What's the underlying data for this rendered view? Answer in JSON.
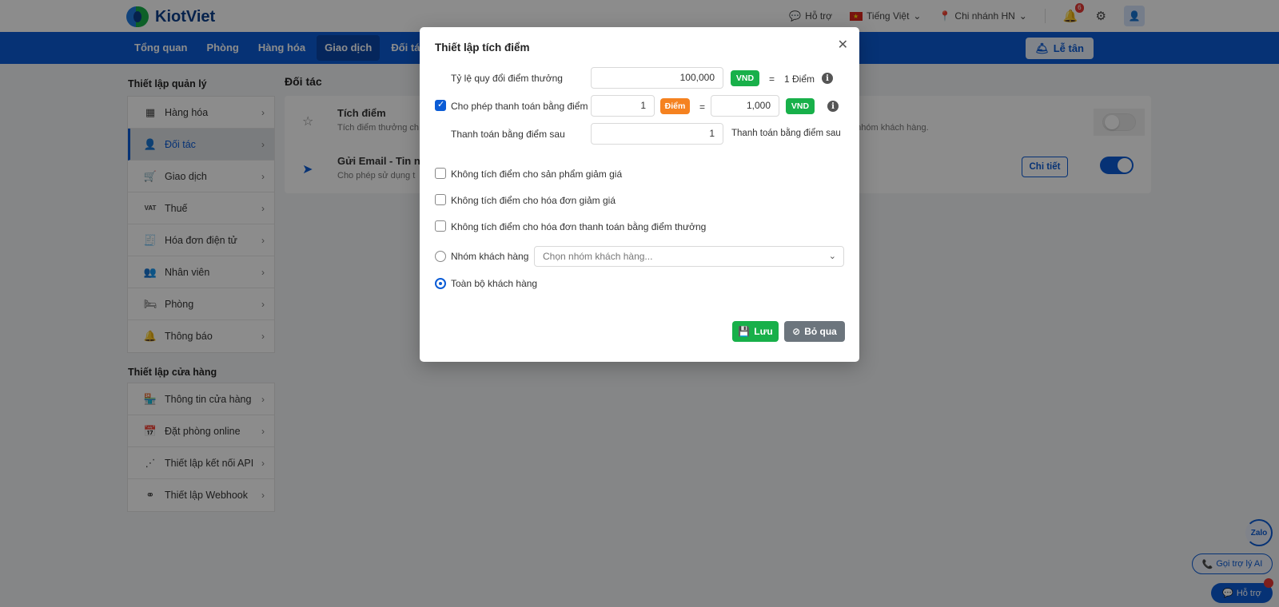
{
  "header": {
    "logo_text": "KiotViet",
    "support": "Hỗ trợ",
    "language": "Tiếng Việt",
    "branch": "Chi nhánh HN",
    "notification_count": "6"
  },
  "nav": {
    "items": [
      "Tổng quan",
      "Phòng",
      "Hàng hóa",
      "Giao dịch",
      "Đối tác"
    ],
    "active": "Giao dịch",
    "reception": "Lễ tân"
  },
  "sidebar": {
    "group1_title": "Thiết lập quản lý",
    "group1_items": [
      {
        "label": "Hàng hóa",
        "icon": "box-icon"
      },
      {
        "label": "Đối tác",
        "icon": "user-icon"
      },
      {
        "label": "Giao dịch",
        "icon": "cart-icon"
      },
      {
        "label": "Thuế",
        "icon": "vat-icon"
      },
      {
        "label": "Hóa đơn điện tử",
        "icon": "invoice-icon"
      },
      {
        "label": "Nhân viên",
        "icon": "staff-icon"
      },
      {
        "label": "Phòng",
        "icon": "bed-icon"
      },
      {
        "label": "Thông báo",
        "icon": "bell-icon"
      }
    ],
    "group2_title": "Thiết lập cửa hàng",
    "group2_items": [
      {
        "label": "Thông tin cửa hàng",
        "icon": "store-icon"
      },
      {
        "label": "Đặt phòng online",
        "icon": "calendar-icon"
      },
      {
        "label": "Thiết lập kết nối API",
        "icon": "api-icon"
      },
      {
        "label": "Thiết lập Webhook",
        "icon": "webhook-icon"
      }
    ]
  },
  "content": {
    "title": "Đối tác",
    "rows": [
      {
        "title": "Tích điểm",
        "desc": "Tích điểm thưởng ch",
        "desc_right": "a nhóm khách hàng.",
        "toggle": "off"
      },
      {
        "title": "Gửi Email - Tin nh",
        "desc": "Cho phép sử dụng t",
        "button": "Chi tiết",
        "toggle": "on"
      }
    ]
  },
  "modal": {
    "title": "Thiết lập tích điểm",
    "rate_label": "Tỷ lệ quy đổi điểm thưởng",
    "rate_value": "100,000",
    "vnd": "VND",
    "equals": "=",
    "one_point": "1 Điểm",
    "allow_pay_label": "Cho phép thanh toán bằng điểm",
    "allow_pay_checked": true,
    "pay_points": "1",
    "point_tag": "Điểm",
    "pay_vnd": "1,000",
    "pay_after_label": "Thanh toán bằng điểm sau",
    "pay_after_value": "1",
    "pay_after_suffix": "Thanh toán bằng điểm sau",
    "options": [
      {
        "label": "Không tích điểm cho sản phẩm giảm giá",
        "checked": false
      },
      {
        "label": "Không tích điểm cho hóa đơn giảm giá",
        "checked": false
      },
      {
        "label": "Không tích điểm cho hóa đơn thanh toán bằng điểm thưởng",
        "checked": false
      }
    ],
    "group_radio_label": "Nhóm khách hàng",
    "group_select_placeholder": "Chọn nhóm khách hàng...",
    "all_radio_label": "Toàn bộ khách hàng",
    "save_label": "Lưu",
    "cancel_label": "Bỏ qua"
  },
  "floating": {
    "zalo": "Zalo",
    "ai_call": "Gọi trợ lý AI",
    "help": "Hỗ trợ"
  },
  "colors": {
    "primary": "#0b5cd6",
    "green": "#18b04a",
    "orange": "#f58220",
    "gray_button": "#6c757d"
  }
}
